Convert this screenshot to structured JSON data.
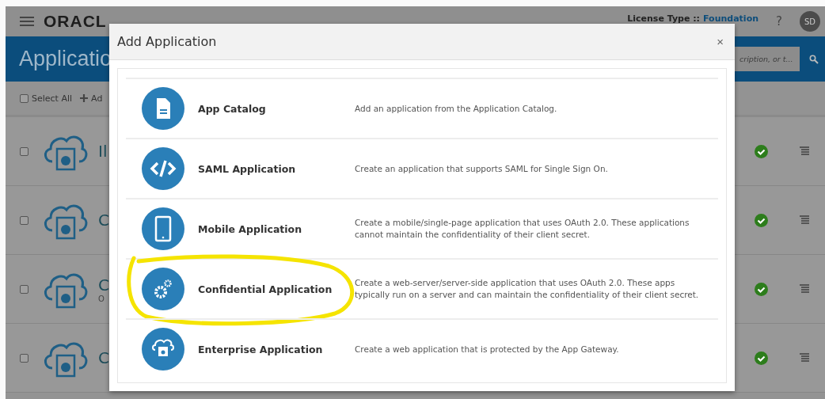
{
  "header": {
    "logo": "ORACL",
    "license_label": "License Type ::",
    "license_value": "Foundation",
    "help": "?",
    "avatar": "SD"
  },
  "banner": {
    "title": "Applicatio",
    "search_placeholder": "cription, or t..."
  },
  "toolbar": {
    "select_all": "Select All",
    "select_all_checked": false,
    "add": "Ad"
  },
  "rows": [
    {
      "name": "Il",
      "checked": false,
      "active": true
    },
    {
      "name": "C",
      "checked": false,
      "active": true
    },
    {
      "name": "C",
      "subtitle": "O",
      "checked": false,
      "active": true
    },
    {
      "name": "C",
      "checked": false,
      "active": true
    }
  ],
  "dialog": {
    "title": "Add Application",
    "close": "×",
    "options": [
      {
        "kind": "catalog",
        "title": "App Catalog",
        "description": "Add an application from the Application Catalog.",
        "highlighted": false
      },
      {
        "kind": "saml",
        "title": "SAML Application",
        "description": "Create an application that supports SAML for Single Sign On.",
        "highlighted": false
      },
      {
        "kind": "mobile",
        "title": "Mobile Application",
        "description": "Create a mobile/single-page application that uses OAuth 2.0. These applications cannot maintain the confidentiality of their client secret.",
        "highlighted": false
      },
      {
        "kind": "confidential",
        "title": "Confidential Application",
        "description": "Create a web-server/server-side application that uses OAuth 2.0. These apps typically run on a server and can maintain the confidentiality of their client secret.",
        "highlighted": true
      },
      {
        "kind": "enterprise",
        "title": "Enterprise Application",
        "description": "Create a web application that is protected by the App Gateway.",
        "highlighted": false
      }
    ]
  }
}
